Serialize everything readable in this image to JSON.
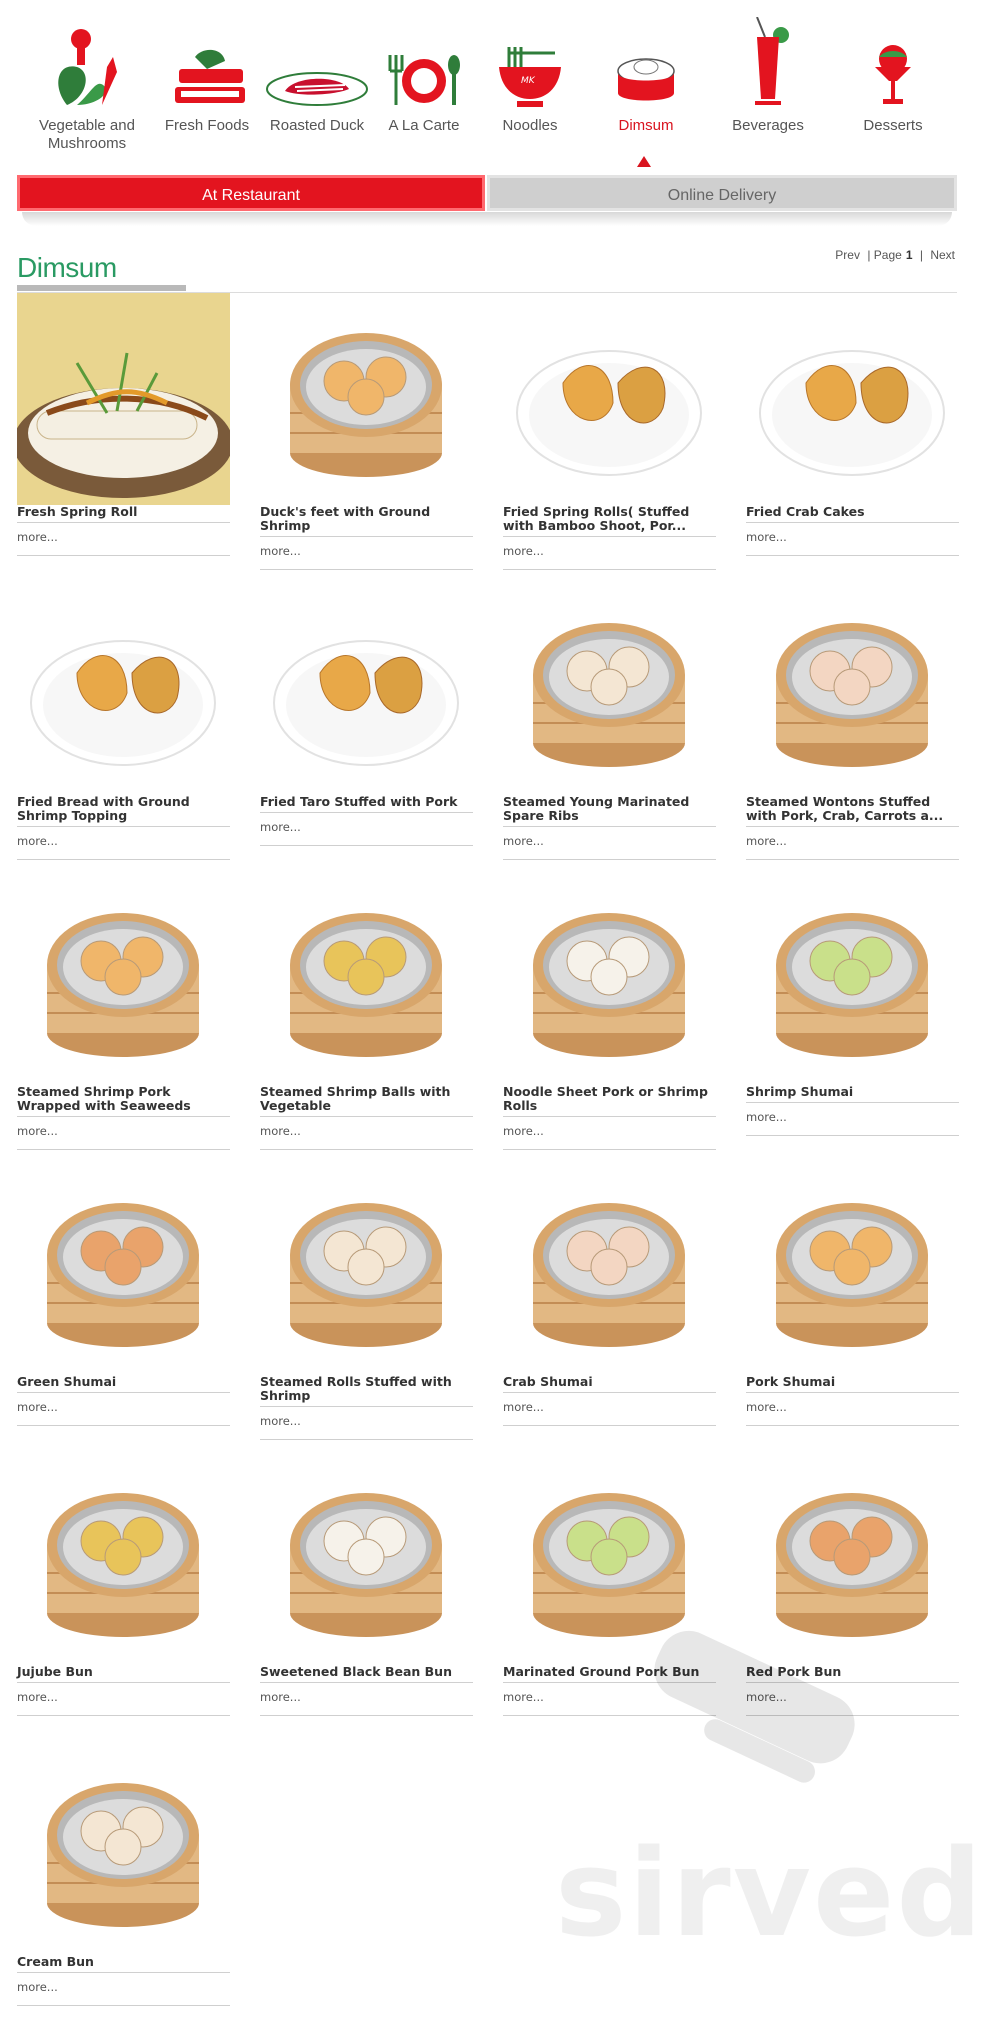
{
  "categories": [
    {
      "label": "Vegetable and Mushrooms",
      "icon": "vegetable-icon",
      "active": false
    },
    {
      "label": "Fresh Foods",
      "icon": "fresh-foods-icon",
      "active": false
    },
    {
      "label": "Roasted Duck",
      "icon": "roasted-duck-icon",
      "active": false
    },
    {
      "label": "A La Carte",
      "icon": "a-la-carte-icon",
      "active": false
    },
    {
      "label": "Noodles",
      "icon": "noodles-icon",
      "active": false
    },
    {
      "label": "Dimsum",
      "icon": "dimsum-icon",
      "active": true
    },
    {
      "label": "Beverages",
      "icon": "beverages-icon",
      "active": false
    },
    {
      "label": "Desserts",
      "icon": "desserts-icon",
      "active": false
    }
  ],
  "tabs": {
    "restaurant": "At Restaurant",
    "delivery": "Online Delivery"
  },
  "section_title": "Dimsum",
  "pager": {
    "prev": "Prev",
    "page_label": "| Page",
    "page": "1",
    "sep": "|",
    "next": "Next"
  },
  "more_label": "more...",
  "items": [
    {
      "name": "Fresh Spring Roll",
      "image": "spring-roll-plate"
    },
    {
      "name": "Duck's feet with Ground Shrimp",
      "image": "steamer-basket"
    },
    {
      "name": "Fried Spring Rolls( Stuffed with Bamboo Shoot, Por...",
      "image": "plate"
    },
    {
      "name": "Fried Crab Cakes",
      "image": "plate"
    },
    {
      "name": "Fried Bread with Ground Shrimp Topping",
      "image": "plate"
    },
    {
      "name": "Fried Taro Stuffed with Pork",
      "image": "plate"
    },
    {
      "name": "Steamed Young Marinated Spare Ribs",
      "image": "steamer-basket"
    },
    {
      "name": "Steamed Wontons Stuffed with Pork, Crab, Carrots a...",
      "image": "steamer-basket"
    },
    {
      "name": "Steamed Shrimp Pork Wrapped with Seaweeds",
      "image": "steamer-basket"
    },
    {
      "name": "Steamed Shrimp Balls with Vegetable",
      "image": "steamer-basket"
    },
    {
      "name": "Noodle Sheet Pork or Shrimp Rolls",
      "image": "steamer-basket"
    },
    {
      "name": "Shrimp Shumai",
      "image": "steamer-basket"
    },
    {
      "name": "Green Shumai",
      "image": "steamer-basket"
    },
    {
      "name": "Steamed Rolls Stuffed with Shrimp",
      "image": "steamer-basket"
    },
    {
      "name": "Crab Shumai",
      "image": "steamer-basket"
    },
    {
      "name": "Pork Shumai",
      "image": "steamer-basket"
    },
    {
      "name": "Jujube Bun",
      "image": "steamer-basket"
    },
    {
      "name": "Sweetened Black Bean Bun",
      "image": "steamer-basket"
    },
    {
      "name": "Marinated Ground Pork Bun",
      "image": "steamer-basket"
    },
    {
      "name": "Red Pork Bun",
      "image": "steamer-basket"
    },
    {
      "name": "Cream Bun",
      "image": "steamer-basket"
    }
  ],
  "watermark": "sirved",
  "colors": {
    "accent": "#e3141f",
    "title_green": "#2a9a63"
  }
}
